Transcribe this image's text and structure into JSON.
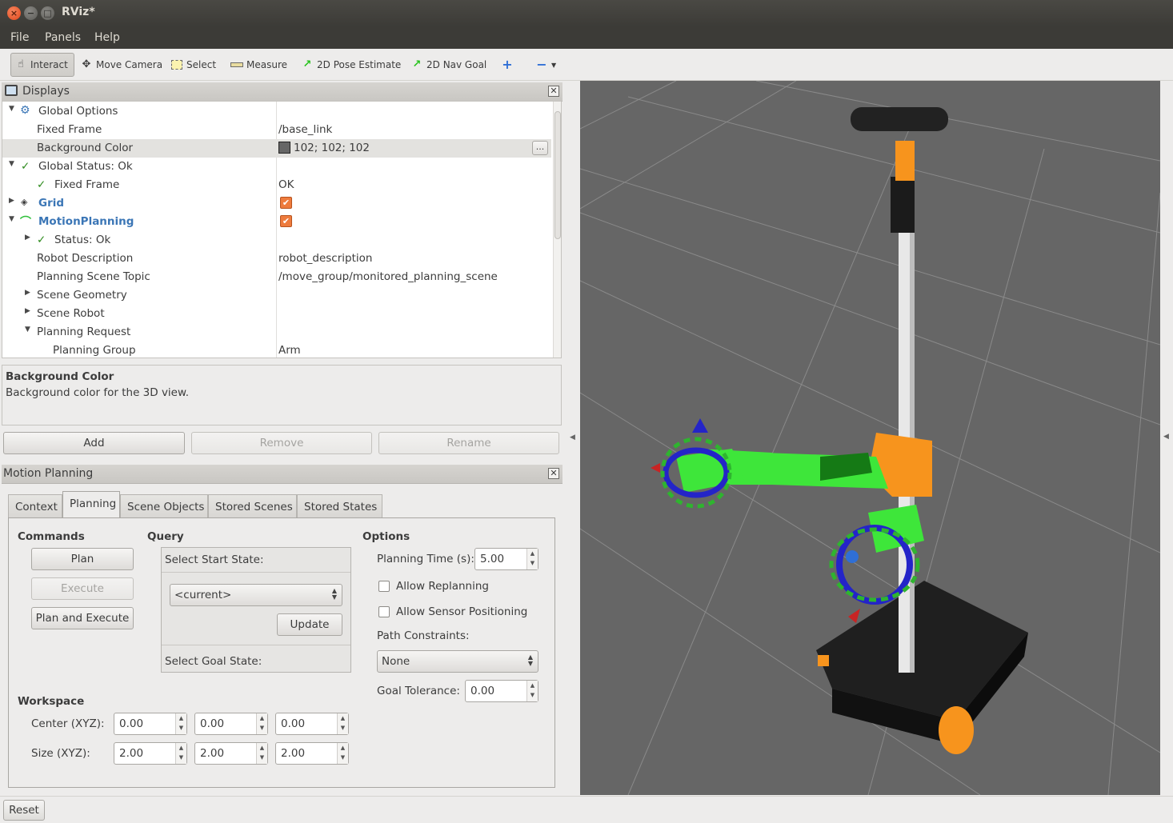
{
  "window": {
    "title": "RViz*"
  },
  "menu": [
    "File",
    "Panels",
    "Help"
  ],
  "toolbar": {
    "interact": "Interact",
    "move_camera": "Move Camera",
    "select": "Select",
    "measure": "Measure",
    "pose_estimate": "2D Pose Estimate",
    "nav_goal": "2D Nav Goal"
  },
  "displays": {
    "title": "Displays",
    "rows": [
      {
        "name": "Global Options",
        "value": ""
      },
      {
        "name": "Fixed Frame",
        "value": "/base_link"
      },
      {
        "name": "Background Color",
        "value": "102; 102; 102"
      },
      {
        "name": "Global Status: Ok",
        "value": ""
      },
      {
        "name": "Fixed Frame",
        "value": "OK"
      },
      {
        "name": "Grid",
        "value": ""
      },
      {
        "name": "MotionPlanning",
        "value": ""
      },
      {
        "name": "Status: Ok",
        "value": ""
      },
      {
        "name": "Robot Description",
        "value": "robot_description"
      },
      {
        "name": "Planning Scene Topic",
        "value": "/move_group/monitored_planning_scene"
      },
      {
        "name": "Scene Geometry",
        "value": ""
      },
      {
        "name": "Scene Robot",
        "value": ""
      },
      {
        "name": "Planning Request",
        "value": ""
      },
      {
        "name": "Planning Group",
        "value": "Arm"
      }
    ],
    "checked": "✔",
    "dots": "..."
  },
  "description": {
    "title": "Background Color",
    "text": "Background color for the 3D view."
  },
  "buttons": {
    "add": "Add",
    "remove": "Remove",
    "rename": "Rename"
  },
  "motion_planning": {
    "title": "Motion Planning",
    "tabs": [
      "Context",
      "Planning",
      "Scene Objects",
      "Stored Scenes",
      "Stored States"
    ],
    "commands": {
      "title": "Commands",
      "plan": "Plan",
      "execute": "Execute",
      "plan_execute": "Plan and Execute"
    },
    "query": {
      "title": "Query",
      "start_label": "Select Start State:",
      "start_value": "<current>",
      "update": "Update",
      "goal_label": "Select Goal State:"
    },
    "options": {
      "title": "Options",
      "planning_time_label": "Planning Time (s):",
      "planning_time": "5.00",
      "allow_replanning": "Allow Replanning",
      "allow_sensor": "Allow Sensor Positioning",
      "path_constraints_label": "Path Constraints:",
      "path_constraints": "None",
      "goal_tolerance_label": "Goal Tolerance:",
      "goal_tolerance": "0.00"
    },
    "workspace": {
      "title": "Workspace",
      "center_label": "Center (XYZ):",
      "center": [
        "0.00",
        "0.00",
        "0.00"
      ],
      "size_label": "Size (XYZ):",
      "size": [
        "2.00",
        "2.00",
        "2.00"
      ]
    }
  },
  "status": {
    "reset": "Reset"
  },
  "colors": {
    "background": "#666666",
    "accent": "#ee7b3d",
    "robot_green": "#3ee63a",
    "robot_orange": "#f7941d"
  }
}
